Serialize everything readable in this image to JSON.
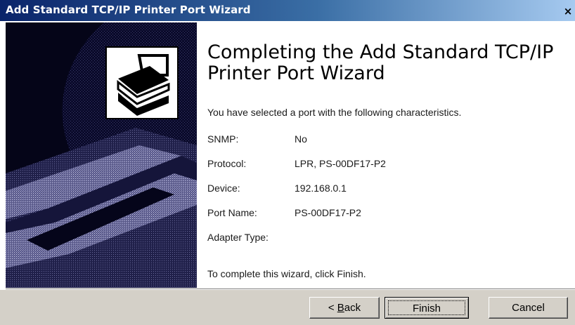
{
  "window": {
    "title": "Add Standard TCP/IP Printer Port Wizard",
    "close_label": "×"
  },
  "content": {
    "heading": "Completing the Add Standard TCP/IP Printer Port Wizard",
    "intro": "You have selected a port with the following characteristics.",
    "properties": [
      {
        "label": "SNMP:",
        "value": "No"
      },
      {
        "label": "Protocol:",
        "value": "LPR, PS-00DF17-P2"
      },
      {
        "label": "Device:",
        "value": "192.168.0.1"
      },
      {
        "label": "Port Name:",
        "value": "PS-00DF17-P2"
      },
      {
        "label": "Adapter Type:",
        "value": ""
      }
    ],
    "footer": "To complete this wizard, click Finish."
  },
  "buttons": {
    "back_prefix": "< ",
    "back_accel": "B",
    "back_rest": "ack",
    "finish": "Finish",
    "cancel": "Cancel"
  },
  "icons": {
    "banner": "printer-icon",
    "close": "close-icon"
  },
  "colors": {
    "titlebar_start": "#0a246a",
    "titlebar_end": "#a6caf0",
    "button_face": "#d4d0c8",
    "banner_bg": "#06061e"
  }
}
